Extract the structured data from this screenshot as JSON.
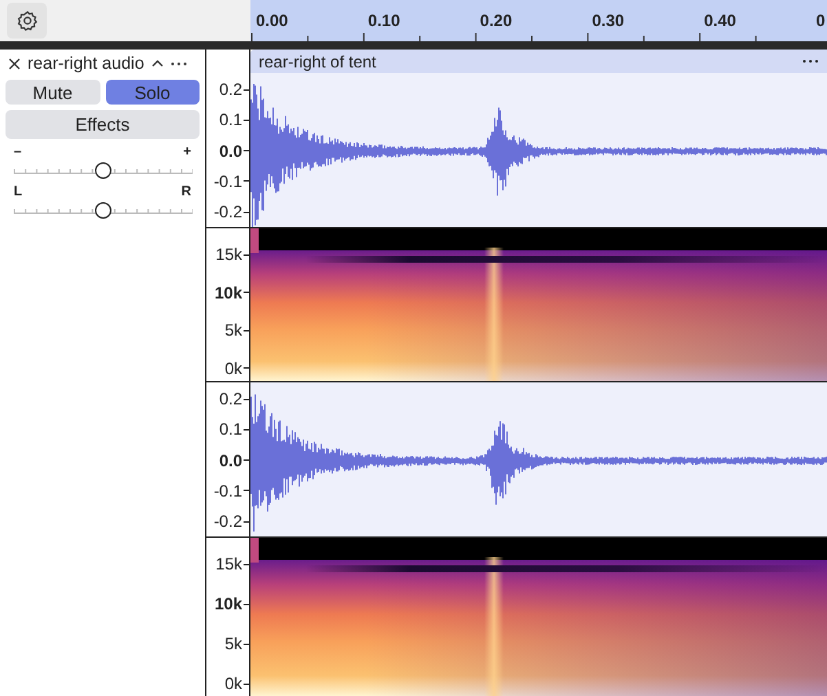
{
  "toolbar": {
    "settings_button": {
      "kind": "gear"
    }
  },
  "timeline": {
    "labels": [
      "0.00",
      "0.10",
      "0.20",
      "0.30",
      "0.40",
      "0"
    ]
  },
  "track": {
    "name": "rear-right audio",
    "buttons": [
      {
        "label": "Mute",
        "selected": false
      },
      {
        "label": "Solo",
        "selected": true
      }
    ],
    "effects": "Effects",
    "gain": {
      "min_label": "–",
      "max_label": "+",
      "level": 0.5
    },
    "pan": {
      "min_label": "L",
      "max_label": "R",
      "level": 0.5
    }
  },
  "clip": {
    "title": "rear-right of tent"
  },
  "channels": [
    {
      "waveform_scale": [
        {
          "text": "0.2",
          "emphasized": false
        },
        {
          "text": "0.1",
          "emphasized": false
        },
        {
          "text": "0.0",
          "emphasized": true
        },
        {
          "text": "-0.1",
          "emphasized": false
        },
        {
          "text": "-0.2",
          "emphasized": false
        }
      ],
      "spectrogram_scale": [
        {
          "text": "15k",
          "emphasized": false
        },
        {
          "text": "10k",
          "emphasized": true
        },
        {
          "text": "5k",
          "emphasized": false
        },
        {
          "text": "0k",
          "emphasized": false
        }
      ]
    },
    {
      "waveform_scale": [
        {
          "text": "0.2",
          "emphasized": false
        },
        {
          "text": "0.1",
          "emphasized": false
        },
        {
          "text": "0.0",
          "emphasized": true
        },
        {
          "text": "-0.1",
          "emphasized": false
        },
        {
          "text": "-0.2",
          "emphasized": false
        }
      ],
      "spectrogram_scale": [
        {
          "text": "15k",
          "emphasized": false
        },
        {
          "text": "10k",
          "emphasized": true
        },
        {
          "text": "5k",
          "emphasized": false
        },
        {
          "text": "0k",
          "emphasized": false
        }
      ]
    }
  ]
}
